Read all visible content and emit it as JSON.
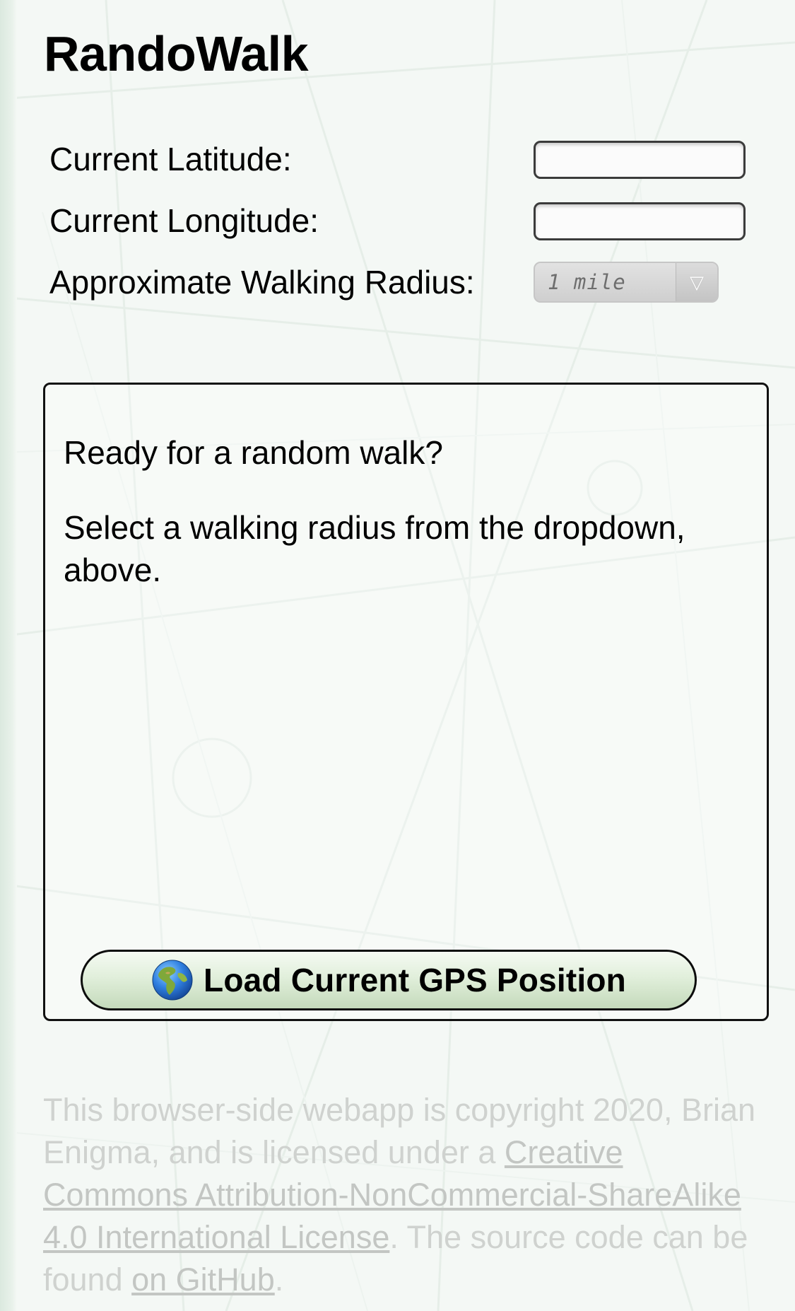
{
  "app": {
    "title": "RandoWalk"
  },
  "form": {
    "latitude_label": "Current Latitude:",
    "latitude_value": "",
    "longitude_label": "Current Longitude:",
    "longitude_value": "",
    "radius_label": "Approximate Walking Radius:",
    "radius_selected": "1 mile",
    "radius_arrow_glyph": "▽"
  },
  "message": {
    "line1": "Ready for a random walk?",
    "line2": "Select a walking radius from the dropdown, above."
  },
  "gps_button": {
    "label": "Load Current GPS Position",
    "icon": "globe-icon"
  },
  "footer": {
    "l1_text": "This browser-side webapp is copyright 2020, Brian",
    "l2_text": "Enigma, and is licensed under a ",
    "l2_link": "Creative",
    "l3_link": "Commons Attribution-NonCommercial-ShareAlike",
    "l4_link": "4.0 International License",
    "l4_text": ". The source code can be",
    "l5_text": "found ",
    "l5_link": "on GitHub",
    "l5_end": "."
  },
  "colors": {
    "background": "#f4f8f5",
    "button_top": "#f5faf3",
    "button_bottom": "#c4dabb",
    "footer_text": "#cfd2cf"
  }
}
